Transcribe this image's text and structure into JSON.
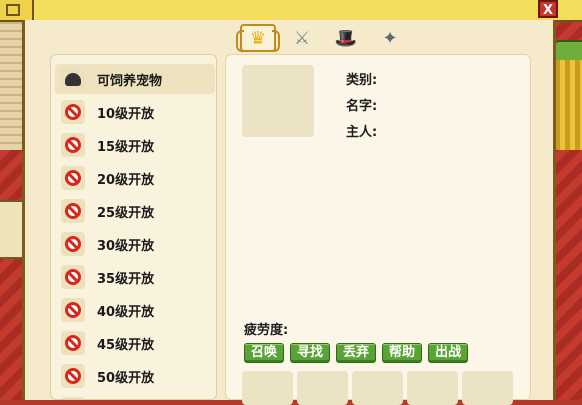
{
  "window": {
    "close_label": "X"
  },
  "tabs": [
    {
      "name": "crown-tab",
      "glyph": "♛",
      "active": true
    },
    {
      "name": "sword-tab",
      "glyph": "⚔",
      "active": false
    },
    {
      "name": "hat-tab",
      "glyph": "🎩",
      "active": false
    },
    {
      "name": "shuriken-tab",
      "glyph": "✦",
      "active": false
    }
  ],
  "pet_list": {
    "items": [
      {
        "label": "可饲养宠物",
        "icon": "pet-silhouette-icon",
        "selected": true
      },
      {
        "label": "10级开放",
        "icon": "no-entry-icon",
        "selected": false
      },
      {
        "label": "15级开放",
        "icon": "no-entry-icon",
        "selected": false
      },
      {
        "label": "20级开放",
        "icon": "no-entry-icon",
        "selected": false
      },
      {
        "label": "25级开放",
        "icon": "no-entry-icon",
        "selected": false
      },
      {
        "label": "30级开放",
        "icon": "no-entry-icon",
        "selected": false
      },
      {
        "label": "35级开放",
        "icon": "no-entry-icon",
        "selected": false
      },
      {
        "label": "40级开放",
        "icon": "no-entry-icon",
        "selected": false
      },
      {
        "label": "45级开放",
        "icon": "no-entry-icon",
        "selected": false
      },
      {
        "label": "50级开放",
        "icon": "no-entry-icon",
        "selected": false
      }
    ]
  },
  "details": {
    "type_label": "类别:",
    "name_label": "名字:",
    "owner_label": "主人:",
    "fatigue_label": "疲劳度:",
    "buttons": {
      "summon": "召唤",
      "find": "寻找",
      "discard": "丢弃",
      "help": "帮助",
      "battle": "出战"
    }
  },
  "colors": {
    "accent_green": "#5aa336",
    "no_entry_red": "#d7281d",
    "frame_gold": "#f3dd5a"
  }
}
